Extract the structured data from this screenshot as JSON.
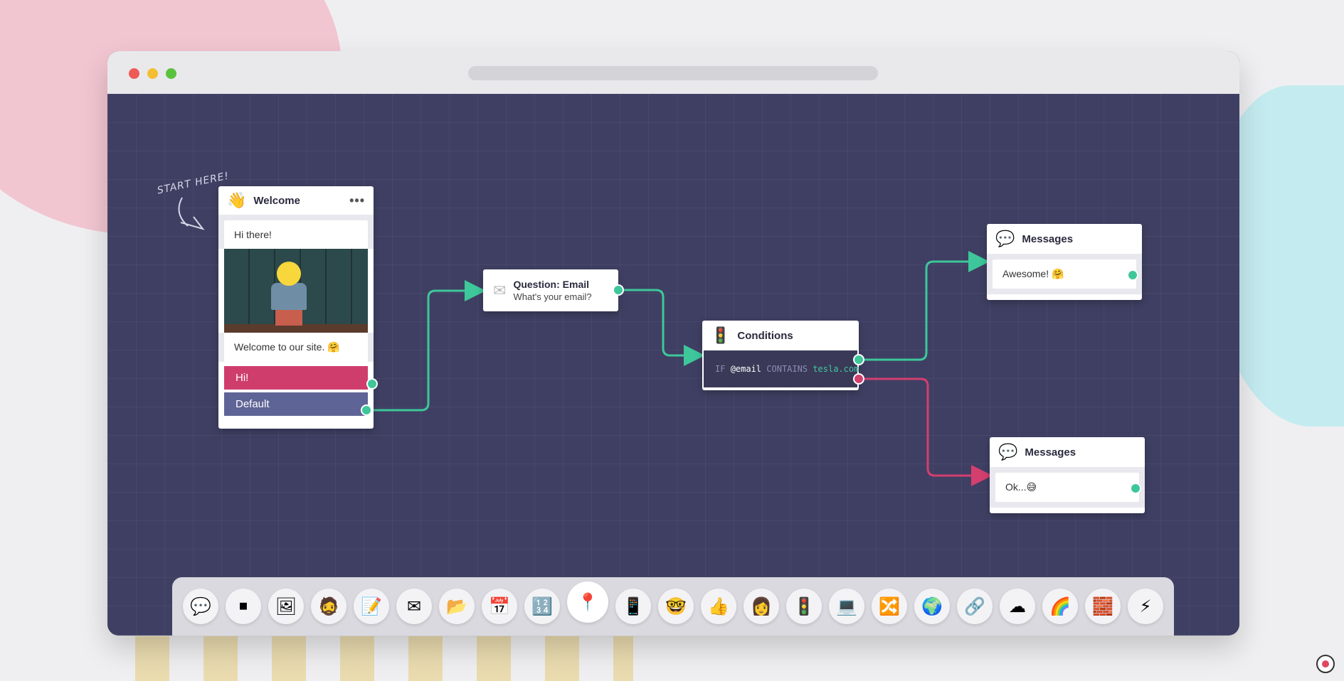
{
  "annotation": {
    "start_here": "START HERE!"
  },
  "colors": {
    "accent_green": "#3ec79a",
    "accent_red": "#d33f6f",
    "canvas": "#3f3f63"
  },
  "nodes": {
    "welcome": {
      "title": "Welcome",
      "icon": "waving-hand-icon",
      "greeting": "Hi there!",
      "message": "Welcome to our site. 🤗",
      "buttons": [
        "Hi!",
        "Default"
      ]
    },
    "question": {
      "title": "Question: Email",
      "prompt": "What's your email?",
      "icon": "envelope-icon"
    },
    "conditions": {
      "title": "Conditions",
      "icon": "traffic-light-icon",
      "keyword_if": "IF",
      "variable": "@email",
      "operator": "CONTAINS",
      "value": "tesla.com"
    },
    "messages_success": {
      "title": "Messages",
      "text": "Awesome! 🤗",
      "icon": "speech-bubble-icon"
    },
    "messages_fail": {
      "title": "Messages",
      "text": "Ok...😅",
      "icon": "speech-bubble-icon"
    }
  },
  "dock": [
    {
      "name": "message",
      "glyph": "💬"
    },
    {
      "name": "stop",
      "glyph": "⏹"
    },
    {
      "name": "image",
      "glyph": "🖼"
    },
    {
      "name": "avatar",
      "glyph": "🧔"
    },
    {
      "name": "note",
      "glyph": "📝"
    },
    {
      "name": "email",
      "glyph": "✉"
    },
    {
      "name": "folder",
      "glyph": "📂"
    },
    {
      "name": "calendar",
      "glyph": "📅"
    },
    {
      "name": "number",
      "glyph": "🔢"
    },
    {
      "name": "location-pin",
      "glyph": "📍"
    },
    {
      "name": "phone",
      "glyph": "📱"
    },
    {
      "name": "nerd-face",
      "glyph": "🤓"
    },
    {
      "name": "thumbs-up",
      "glyph": "👍"
    },
    {
      "name": "person",
      "glyph": "👩"
    },
    {
      "name": "traffic-light",
      "glyph": "🚦"
    },
    {
      "name": "laptop",
      "glyph": "💻"
    },
    {
      "name": "shuffle",
      "glyph": "🔀"
    },
    {
      "name": "globe",
      "glyph": "🌍"
    },
    {
      "name": "link",
      "glyph": "🔗"
    },
    {
      "name": "cloud",
      "glyph": "☁"
    },
    {
      "name": "rainbow",
      "glyph": "🌈"
    },
    {
      "name": "box",
      "glyph": "🧱"
    },
    {
      "name": "lightning",
      "glyph": "⚡"
    }
  ]
}
